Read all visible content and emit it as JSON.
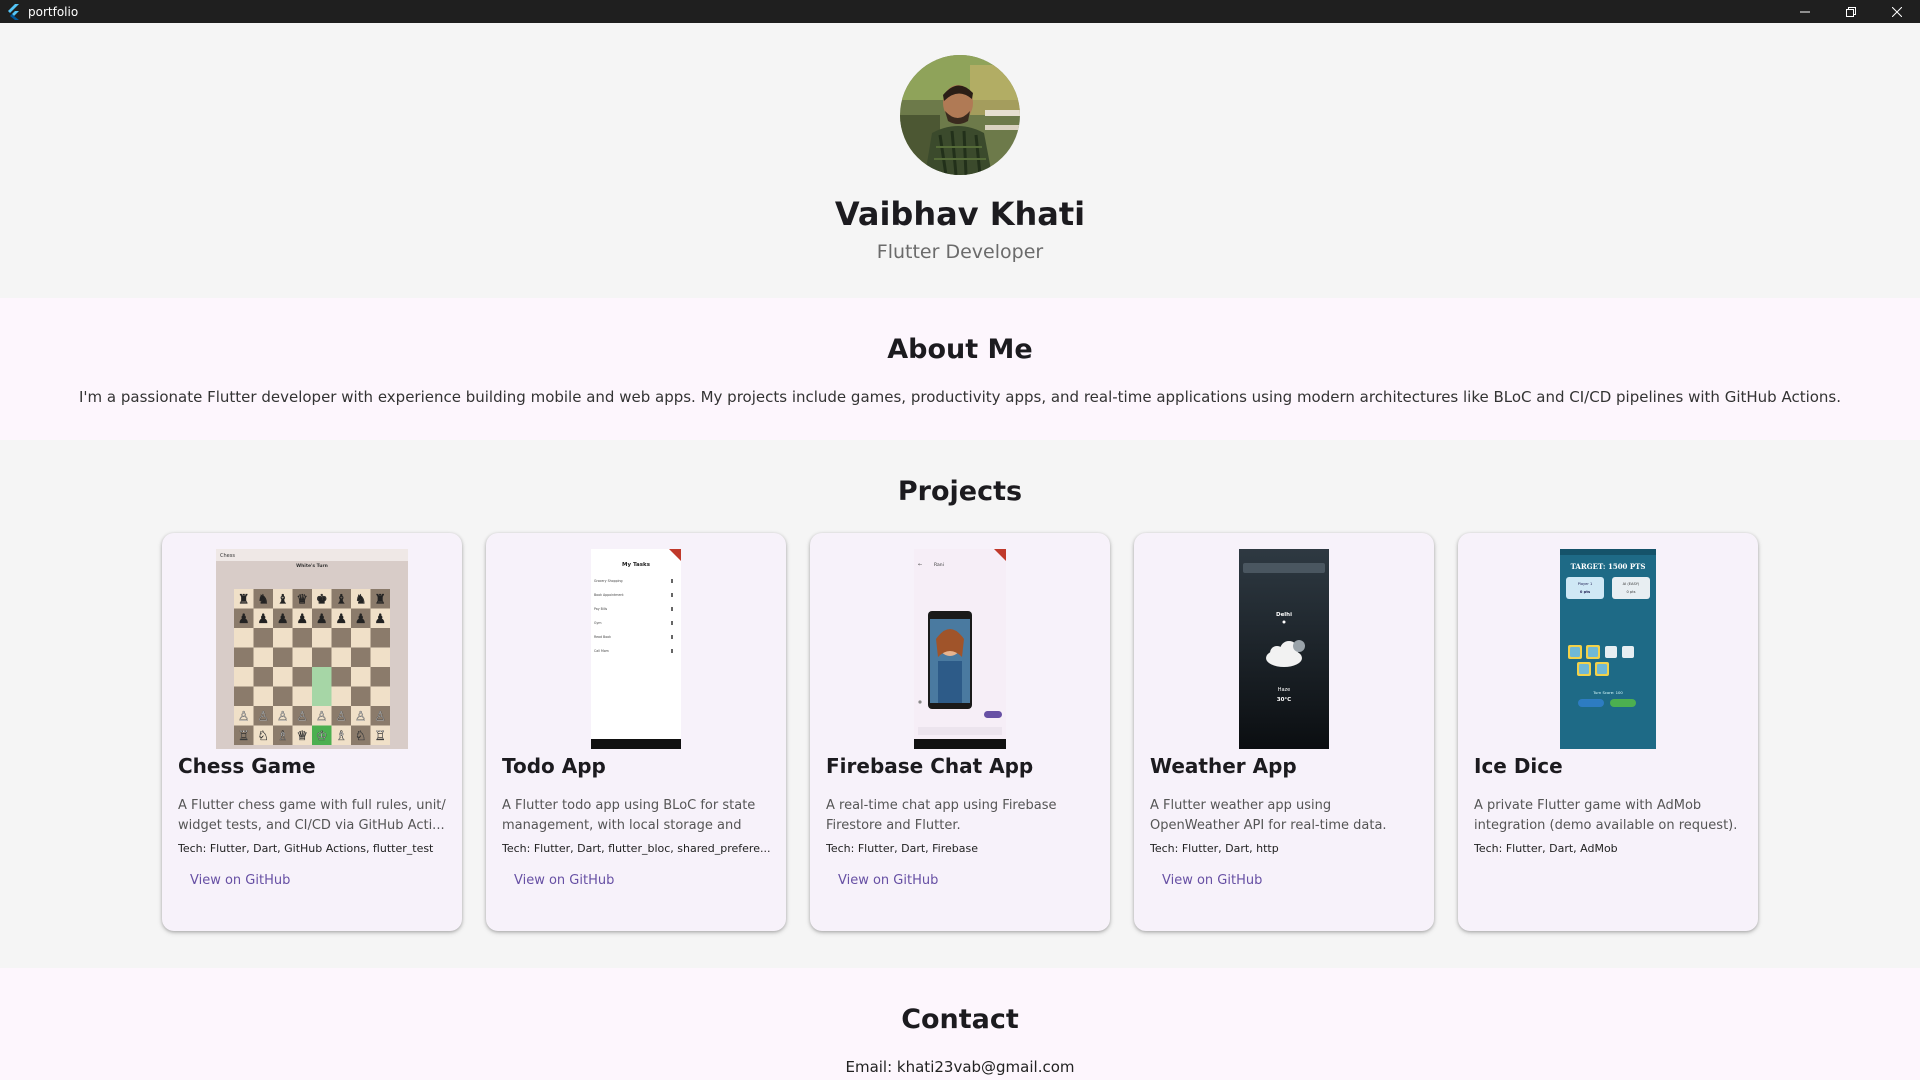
{
  "window": {
    "title": "portfolio"
  },
  "profile": {
    "name": "Vaibhav Khati",
    "role": "Flutter Developer"
  },
  "about": {
    "heading": "About Me",
    "text": "I'm a passionate Flutter developer with experience building mobile and web apps. My projects include games, productivity apps, and real-time applications using modern architectures like BLoC and CI/CD pipelines with GitHub Actions."
  },
  "projects": {
    "heading": "Projects",
    "items": [
      {
        "title": "Chess Game",
        "description": "A Flutter chess game with full rules, unit/ widget tests, and CI/CD via GitHub Acti...",
        "tech": "Tech: Flutter, Dart, GitHub Actions, flutter_test",
        "link": "View on GitHub"
      },
      {
        "title": "Todo App",
        "description": "A Flutter todo app using BLoC for state management, with local storage and tes...",
        "tech": "Tech: Flutter, Dart, flutter_bloc, shared_prefere...",
        "link": "View on GitHub"
      },
      {
        "title": "Firebase Chat App",
        "description": "A real-time chat app using Firebase Firestore and Flutter.",
        "tech": "Tech: Flutter, Dart, Firebase",
        "link": "View on GitHub"
      },
      {
        "title": "Weather App",
        "description": "A Flutter weather app using OpenWeather API for real-time data.",
        "tech": "Tech: Flutter, Dart, http",
        "link": "View on GitHub"
      },
      {
        "title": "Ice Dice",
        "description": "A private Flutter game with AdMob integration (demo available on request).",
        "tech": "Tech: Flutter, Dart, AdMob"
      }
    ]
  },
  "screenshots": {
    "chess": {
      "app_title": "Chess",
      "turn": "White's Turn"
    },
    "todo": {
      "header": "My Tasks",
      "tasks": [
        "Grocery Shopping",
        "Book Appointment",
        "Pay Bills",
        "Gym",
        "Read Book",
        "Call Mom"
      ]
    },
    "chat": {
      "contact": "Rani"
    },
    "weather": {
      "city": "Delhi",
      "condition": "Haze",
      "temp": "30°C"
    },
    "dice": {
      "target": "TARGET: 1500 PTS",
      "player1": "Player 1",
      "player1_pts": "0 pts",
      "player2": "AI (EASY)",
      "player2_pts": "0 pts",
      "turn_score": "Turn Score: 100"
    }
  },
  "contact": {
    "heading": "Contact",
    "email": "Email: khati23vab@gmail.com"
  },
  "colors": {
    "accent": "#6750a4",
    "page_bg": "#f5f5f5",
    "section_bg": "#fdf6fd",
    "card_bg": "#f7f2fa",
    "titlebar": "#1f1f1f"
  }
}
